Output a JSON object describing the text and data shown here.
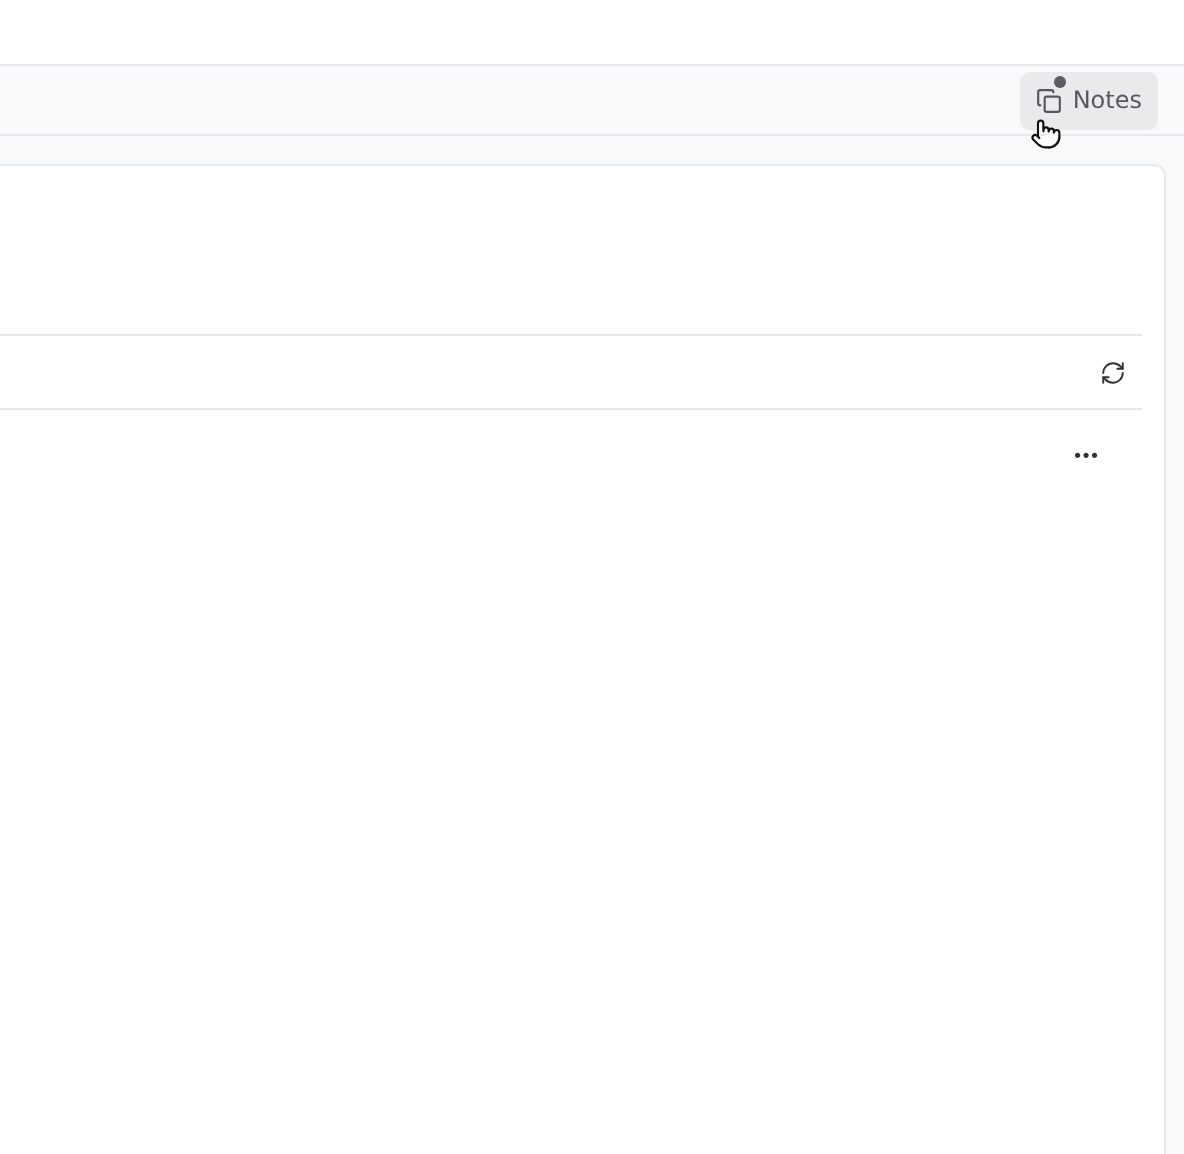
{
  "toolbar": {
    "notes_button": {
      "label": "Notes",
      "has_unread": true
    }
  },
  "card": {
    "refresh": true,
    "row_menu": "•••"
  }
}
